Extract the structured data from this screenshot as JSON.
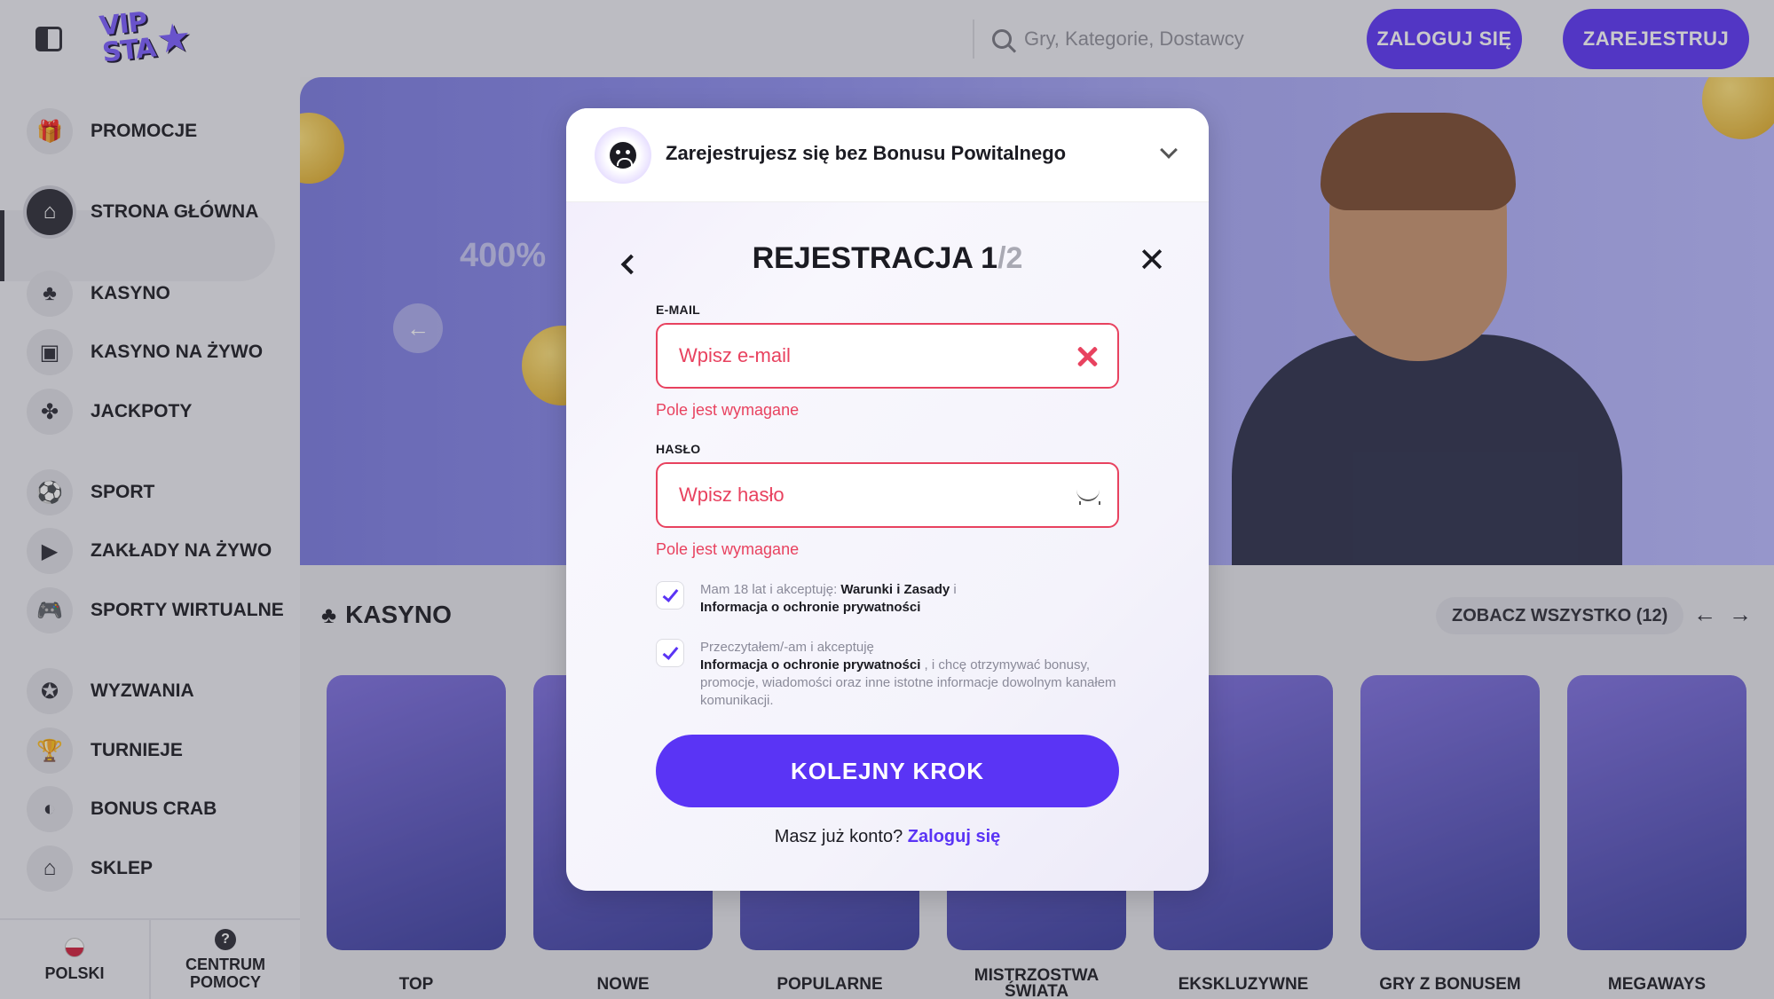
{
  "topbar": {
    "logo_text": "VIP STA",
    "search_placeholder": "Gry, Kategorie, Dostawcy",
    "login_label": "ZALOGUJ SIĘ",
    "register_label": "ZAREJESTRUJ"
  },
  "sidebar": {
    "items": [
      {
        "label": "PROMOCJE",
        "icon": "gift-icon"
      },
      {
        "label": "STRONA GŁÓWNA",
        "icon": "home-icon"
      },
      {
        "label": "KASYNO",
        "icon": "cherries-icon"
      },
      {
        "label": "KASYNO NA ŻYWO",
        "icon": "live-casino-icon"
      },
      {
        "label": "JACKPOTY",
        "icon": "clover-icon"
      },
      {
        "label": "SPORT",
        "icon": "soccer-ball-icon"
      },
      {
        "label": "ZAKŁADY NA ŻYWO",
        "icon": "play-icon"
      },
      {
        "label": "SPORTY WIRTUALNE",
        "icon": "gamepad-icon"
      },
      {
        "label": "WYZWANIA",
        "icon": "medal-icon"
      },
      {
        "label": "TURNIEJE",
        "icon": "trophy-icon"
      },
      {
        "label": "BONUS CRAB",
        "icon": "crab-icon"
      },
      {
        "label": "SKLEP",
        "icon": "shop-icon"
      }
    ],
    "footer_language": "POLSKI",
    "footer_help": "CENTRUM POMOCY"
  },
  "hero": {
    "promo_text": "400%"
  },
  "casino_section": {
    "title": "KASYNO",
    "see_all": "ZOBACZ WSZYSTKO (12)",
    "categories": [
      "TOP",
      "NOWE",
      "POPULARNE",
      "MISTRZOSTWA ŚWIATA",
      "EKSKLUZYWNE",
      "GRY Z BONUSEM",
      "MEGAWAYS"
    ]
  },
  "modal": {
    "bonus_bar_text": "Zarejestrujesz się bez Bonusu Powitalnego",
    "title_main": "REJESTRACJA 1",
    "title_total": "/2",
    "email_label": "E-MAIL",
    "email_placeholder": "Wpisz e-mail",
    "email_error": "Pole jest wymagane",
    "password_label": "HASŁO",
    "password_placeholder": "Wpisz hasło",
    "password_error": "Pole jest wymagane",
    "consent1_prefix": "Mam 18 lat i akceptuję: ",
    "consent1_terms": "Warunki i Zasady",
    "consent1_and": " i ",
    "consent1_privacy": "Informacja o ochronie prywatności",
    "consent2_prefix": "Przeczytałem/-am i akceptuję ",
    "consent2_privacy": "Informacja o ochronie prywatności",
    "consent2_suffix": " , i chcę otrzymywać bonusy, promocje, wiadomości oraz inne istotne informacje dowolnym kanałem komunikacji.",
    "next_button": "KOLEJNY KROK",
    "have_account": "Masz już konto? ",
    "login_link": "Zaloguj się"
  },
  "colors": {
    "accent": "#5a34f5",
    "error": "#e8425f"
  }
}
